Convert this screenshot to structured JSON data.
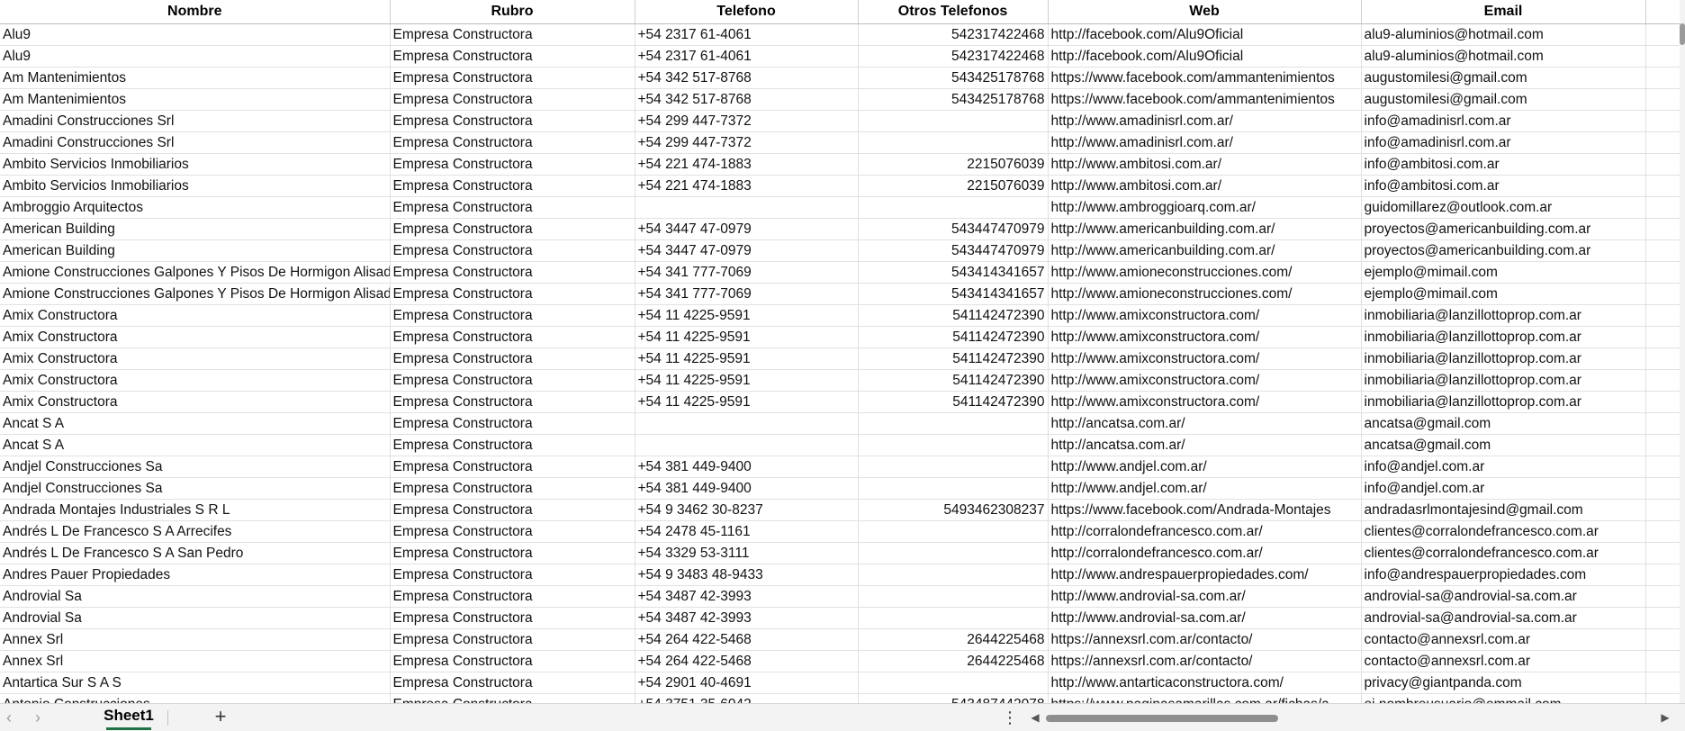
{
  "sheet": {
    "headers": [
      "Nombre",
      "Rubro",
      "Telefono",
      "Otros Telefonos",
      "Web",
      "Email"
    ],
    "rows": [
      [
        "Alu9",
        "Empresa Constructora",
        "+54 2317 61-4061",
        "542317422468",
        "http://facebook.com/Alu9Oficial",
        "alu9-aluminios@hotmail.com"
      ],
      [
        "Alu9",
        "Empresa Constructora",
        "+54 2317 61-4061",
        "542317422468",
        "http://facebook.com/Alu9Oficial",
        "alu9-aluminios@hotmail.com"
      ],
      [
        "Am Mantenimientos",
        "Empresa Constructora",
        "+54 342 517-8768",
        "543425178768",
        "https://www.facebook.com/ammantenimientos",
        "augustomilesi@gmail.com"
      ],
      [
        "Am Mantenimientos",
        "Empresa Constructora",
        "+54 342 517-8768",
        "543425178768",
        "https://www.facebook.com/ammantenimientos",
        "augustomilesi@gmail.com"
      ],
      [
        "Amadini Construcciones Srl",
        "Empresa Constructora",
        "+54 299 447-7372",
        "",
        "http://www.amadinisrl.com.ar/",
        "info@amadinisrl.com.ar"
      ],
      [
        "Amadini Construcciones Srl",
        "Empresa Constructora",
        "+54 299 447-7372",
        "",
        "http://www.amadinisrl.com.ar/",
        "info@amadinisrl.com.ar"
      ],
      [
        "Ambito Servicios Inmobiliarios",
        "Empresa Constructora",
        "+54 221 474-1883",
        "2215076039",
        "http://www.ambitosi.com.ar/",
        "info@ambitosi.com.ar"
      ],
      [
        "Ambito Servicios Inmobiliarios",
        "Empresa Constructora",
        "+54 221 474-1883",
        "2215076039",
        "http://www.ambitosi.com.ar/",
        "info@ambitosi.com.ar"
      ],
      [
        "Ambroggio Arquitectos",
        "Empresa Constructora",
        "",
        "",
        "http://www.ambroggioarq.com.ar/",
        "guidomillarez@outlook.com.ar"
      ],
      [
        "American Building",
        "Empresa Constructora",
        "+54 3447 47-0979",
        "543447470979",
        "http://www.americanbuilding.com.ar/",
        "proyectos@americanbuilding.com.ar"
      ],
      [
        "American Building",
        "Empresa Constructora",
        "+54 3447 47-0979",
        "543447470979",
        "http://www.americanbuilding.com.ar/",
        "proyectos@americanbuilding.com.ar"
      ],
      [
        "Amione Construcciones Galpones Y Pisos De Hormigon Alisado",
        "Empresa Constructora",
        "+54 341 777-7069",
        "543414341657",
        "http://www.amioneconstrucciones.com/",
        "ejemplo@mimail.com"
      ],
      [
        "Amione Construcciones Galpones Y Pisos De Hormigon Alisado",
        "Empresa Constructora",
        "+54 341 777-7069",
        "543414341657",
        "http://www.amioneconstrucciones.com/",
        "ejemplo@mimail.com"
      ],
      [
        "Amix Constructora",
        "Empresa Constructora",
        "+54 11 4225-9591",
        "541142472390",
        "http://www.amixconstructora.com/",
        "inmobiliaria@lanzillottoprop.com.ar"
      ],
      [
        "Amix Constructora",
        "Empresa Constructora",
        "+54 11 4225-9591",
        "541142472390",
        "http://www.amixconstructora.com/",
        "inmobiliaria@lanzillottoprop.com.ar"
      ],
      [
        "Amix Constructora",
        "Empresa Constructora",
        "+54 11 4225-9591",
        "541142472390",
        "http://www.amixconstructora.com/",
        "inmobiliaria@lanzillottoprop.com.ar"
      ],
      [
        "Amix Constructora",
        "Empresa Constructora",
        "+54 11 4225-9591",
        "541142472390",
        "http://www.amixconstructora.com/",
        "inmobiliaria@lanzillottoprop.com.ar"
      ],
      [
        "Amix Constructora",
        "Empresa Constructora",
        "+54 11 4225-9591",
        "541142472390",
        "http://www.amixconstructora.com/",
        "inmobiliaria@lanzillottoprop.com.ar"
      ],
      [
        "Ancat S A",
        "Empresa Constructora",
        "",
        "",
        "http://ancatsa.com.ar/",
        "ancatsa@gmail.com"
      ],
      [
        "Ancat S A",
        "Empresa Constructora",
        "",
        "",
        "http://ancatsa.com.ar/",
        "ancatsa@gmail.com"
      ],
      [
        "Andjel Construcciones Sa",
        "Empresa Constructora",
        "+54 381 449-9400",
        "",
        "http://www.andjel.com.ar/",
        "info@andjel.com.ar"
      ],
      [
        "Andjel Construcciones Sa",
        "Empresa Constructora",
        "+54 381 449-9400",
        "",
        "http://www.andjel.com.ar/",
        "info@andjel.com.ar"
      ],
      [
        "Andrada Montajes Industriales S R L",
        "Empresa Constructora",
        "+54 9 3462 30-8237",
        "5493462308237",
        "https://www.facebook.com/Andrada-Montajes",
        "andradasrlmontajesind@gmail.com"
      ],
      [
        "Andrés L De Francesco S A Arrecifes",
        "Empresa Constructora",
        "+54 2478 45-1161",
        "",
        "http://corralondefrancesco.com.ar/",
        "clientes@corralondefrancesco.com.ar"
      ],
      [
        "Andrés L De Francesco S A San Pedro",
        "Empresa Constructora",
        "+54 3329 53-3111",
        "",
        "http://corralondefrancesco.com.ar/",
        "clientes@corralondefrancesco.com.ar"
      ],
      [
        "Andres Pauer Propiedades",
        "Empresa Constructora",
        "+54 9 3483 48-9433",
        "",
        "http://www.andrespauerpropiedades.com/",
        "info@andrespauerpropiedades.com"
      ],
      [
        "Androvial Sa",
        "Empresa Constructora",
        "+54 3487 42-3993",
        "",
        "http://www.androvial-sa.com.ar/",
        "androvial-sa@androvial-sa.com.ar"
      ],
      [
        "Androvial Sa",
        "Empresa Constructora",
        "+54 3487 42-3993",
        "",
        "http://www.androvial-sa.com.ar/",
        "androvial-sa@androvial-sa.com.ar"
      ],
      [
        "Annex Srl",
        "Empresa Constructora",
        "+54 264 422-5468",
        "2644225468",
        "https://annexsrl.com.ar/contacto/",
        "contacto@annexsrl.com.ar"
      ],
      [
        "Annex Srl",
        "Empresa Constructora",
        "+54 264 422-5468",
        "2644225468",
        "https://annexsrl.com.ar/contacto/",
        "contacto@annexsrl.com.ar"
      ],
      [
        "Antartica Sur S A S",
        "Empresa Constructora",
        "+54 2901 40-4691",
        "",
        "http://www.antarticaconstructora.com/",
        "privacy@giantpanda.com"
      ],
      [
        "Antonio Construcciones",
        "Empresa Constructora",
        "+54 3751 35-6042",
        "543487442078",
        "https://www.paginasamarillas.com.ar/fichas/a",
        "ej.nombreusuario@emmail.com"
      ]
    ]
  },
  "footer": {
    "sheet_tab": "Sheet1",
    "add_sheet": "+",
    "more": "⋮",
    "prev": "‹",
    "next": "›",
    "scroll_left": "◀",
    "scroll_right": "▶"
  },
  "colors": {
    "active_tab_underline": "#217346",
    "scroll_thumb": "#8e8e8e"
  },
  "scroll": {
    "horizontal_position": 0.0,
    "horizontal_visible_fraction": 0.38
  }
}
